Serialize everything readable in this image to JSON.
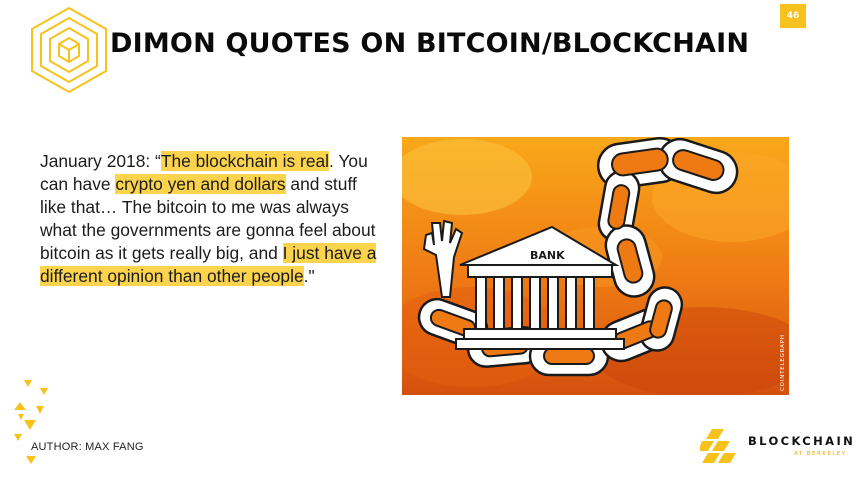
{
  "slide": {
    "page_number": "46",
    "title": "DIMON QUOTES ON BITCOIN/BLOCKCHAIN"
  },
  "quote": {
    "lead": "January 2018: “",
    "hl1": "The blockchain is real",
    "t1": ". You can have ",
    "hl2": "crypto yen and dollars",
    "t2": " and stuff like that… The bitcoin to me was always what the governments are gonna feel about bitcoin as it gets really big, and ",
    "hl3": "I just have a different opinion than other people",
    "t3": ".\""
  },
  "illustration": {
    "bank_sign": "BANK",
    "watermark": "COINTELEGRAPH"
  },
  "footer": {
    "author": "AUTHOR: MAX FANG",
    "brand_name": "BLOCKCHAIN",
    "brand_sub": "AT BERKELEY"
  },
  "colors": {
    "accent": "#f7c21d",
    "highlight": "#fcd34d",
    "illustration_orange": "#ef7a14"
  },
  "icons": {
    "logo": "hexagon-cube-logo-icon",
    "decor": "triangles-decoration-icon",
    "brand": "blockchain-at-berkeley-logo-icon"
  }
}
